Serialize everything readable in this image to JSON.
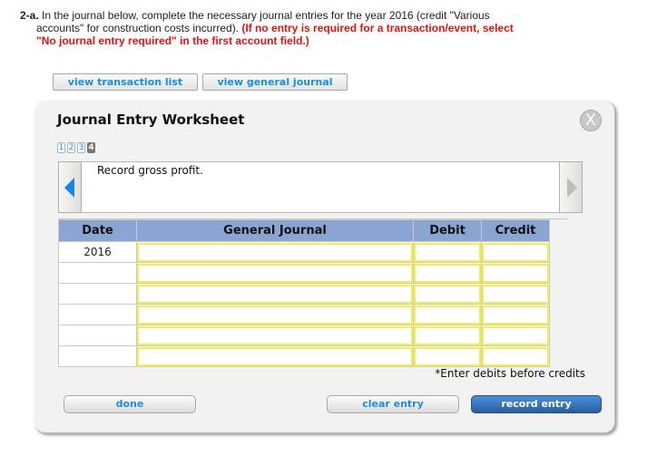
{
  "instructions": {
    "lead": "2-a.",
    "line1": " In the journal below, complete the necessary journal entries for the year 2016 (credit \"Various",
    "line2": "accounts\" for construction costs incurred). ",
    "red1": "(If no entry is required for a transaction/event, select",
    "red2": "\"No journal entry required\" in the first account field.)"
  },
  "toolbar": {
    "view_transaction_list": "view transaction list",
    "view_general_journal": "view general journal"
  },
  "worksheet": {
    "title": "Journal Entry Worksheet",
    "close_label": "X",
    "steps": [
      "1",
      "2",
      "3",
      "4"
    ],
    "active_step": "4",
    "description": "Record gross profit.",
    "table": {
      "headers": [
        "Date",
        "General Journal",
        "Debit",
        "Credit"
      ],
      "rows": [
        {
          "date": "2016",
          "account": "",
          "debit": "",
          "credit": ""
        },
        {
          "date": "",
          "account": "",
          "debit": "",
          "credit": ""
        },
        {
          "date": "",
          "account": "",
          "debit": "",
          "credit": ""
        },
        {
          "date": "",
          "account": "",
          "debit": "",
          "credit": ""
        },
        {
          "date": "",
          "account": "",
          "debit": "",
          "credit": ""
        },
        {
          "date": "",
          "account": "",
          "debit": "",
          "credit": ""
        }
      ]
    },
    "note": "*Enter debits before credits",
    "buttons": {
      "done": "done",
      "clear_entry": "clear entry",
      "record_entry": "record entry"
    }
  },
  "colors": {
    "header_blue": "#8ba5d3",
    "input_border_yellow": "#f4ee52",
    "instruction_red": "#e8100e",
    "link_blue": "#1b8ee0"
  }
}
